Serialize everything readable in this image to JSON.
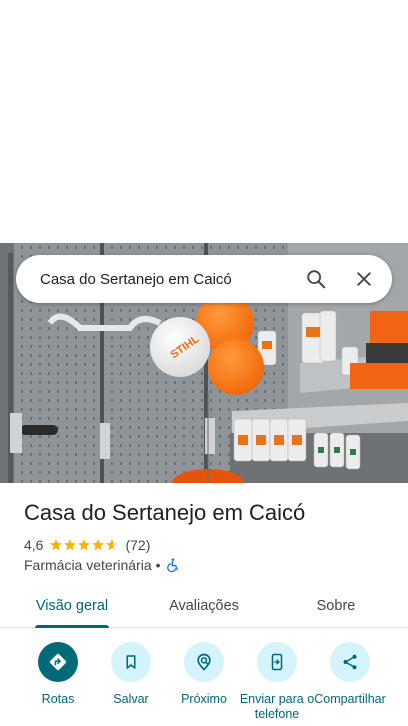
{
  "search": {
    "query": "Casa do Sertanejo em Caicó",
    "search_icon": "search-icon",
    "close_icon": "close-icon"
  },
  "hero": {
    "balloon_text": "STIHL"
  },
  "place": {
    "title": "Casa do Sertanejo em Caicó",
    "rating": "4,6",
    "rating_value": 4.6,
    "stars_max": 5,
    "review_count": "(72)",
    "category": "Farmácia veterinária",
    "separator": "•",
    "accessibility_icon": "wheelchair-icon"
  },
  "tabs": [
    {
      "label": "Visão geral",
      "active": true
    },
    {
      "label": "Avaliações",
      "active": false
    },
    {
      "label": "Sobre",
      "active": false
    }
  ],
  "actions": [
    {
      "label": "Rotas",
      "icon": "directions-icon"
    },
    {
      "label": "Salvar",
      "icon": "bookmark-icon"
    },
    {
      "label": "Próximo",
      "icon": "nearby-icon"
    },
    {
      "label": "Enviar para o telefone",
      "icon": "send-to-phone-icon"
    },
    {
      "label": "Compartilhar",
      "icon": "share-icon"
    }
  ],
  "colors": {
    "accent": "#00677a",
    "action_bg": "#d4f3fa",
    "primary_action_bg": "#006a79",
    "star": "#f4b400"
  }
}
